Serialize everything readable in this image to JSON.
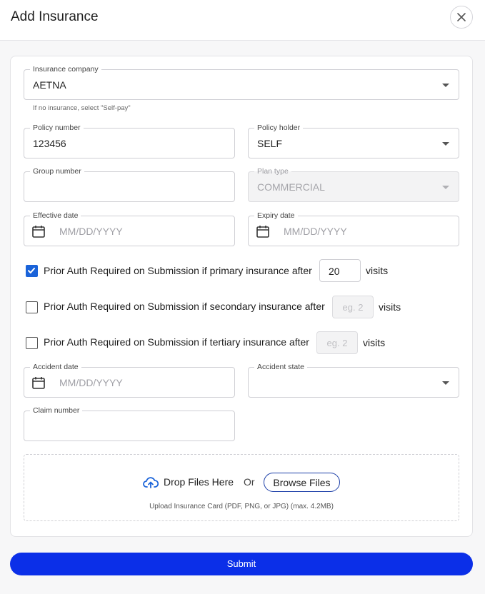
{
  "dialog": {
    "title": "Add Insurance"
  },
  "icons": {
    "close": "close-icon",
    "calendar": "calendar-icon",
    "caret": "chevron-down-icon",
    "cloud": "cloud-upload-icon",
    "check": "check-icon"
  },
  "colors": {
    "accent": "#0b2fe8",
    "checkbox": "#1a63d9",
    "browse_border": "#1c3fa8"
  },
  "fields": {
    "insurance_company": {
      "label": "Insurance company",
      "value": "AETNA",
      "helper": "If no insurance, select \"Self-pay\""
    },
    "policy_number": {
      "label": "Policy number",
      "value": "123456"
    },
    "policy_holder": {
      "label": "Policy holder",
      "value": "SELF"
    },
    "group_number": {
      "label": "Group number",
      "value": ""
    },
    "plan_type": {
      "label": "Plan type",
      "value": "COMMERCIAL"
    },
    "effective_date": {
      "label": "Effective date",
      "placeholder": "MM/DD/YYYY"
    },
    "expiry_date": {
      "label": "Expiry date",
      "placeholder": "MM/DD/YYYY"
    },
    "accident_date": {
      "label": "Accident date",
      "placeholder": "MM/DD/YYYY"
    },
    "accident_state": {
      "label": "Accident state",
      "value": ""
    },
    "claim_number": {
      "label": "Claim number",
      "value": ""
    }
  },
  "prior_auth": [
    {
      "label": "Prior Auth Required on Submission if primary insurance after",
      "checked": true,
      "value": "20",
      "placeholder": "",
      "unit": "visits"
    },
    {
      "label": "Prior Auth Required on Submission if secondary insurance after",
      "checked": false,
      "value": "",
      "placeholder": "eg. 2",
      "unit": "visits"
    },
    {
      "label": "Prior Auth Required on Submission if tertiary insurance after",
      "checked": false,
      "value": "",
      "placeholder": "eg. 2",
      "unit": "visits"
    }
  ],
  "upload": {
    "drop_text": "Drop Files Here",
    "or_text": "Or",
    "browse_label": "Browse Files",
    "hint": "Upload Insurance Card (PDF, PNG, or JPG) (max. 4.2MB)"
  },
  "submit_label": "Submit"
}
